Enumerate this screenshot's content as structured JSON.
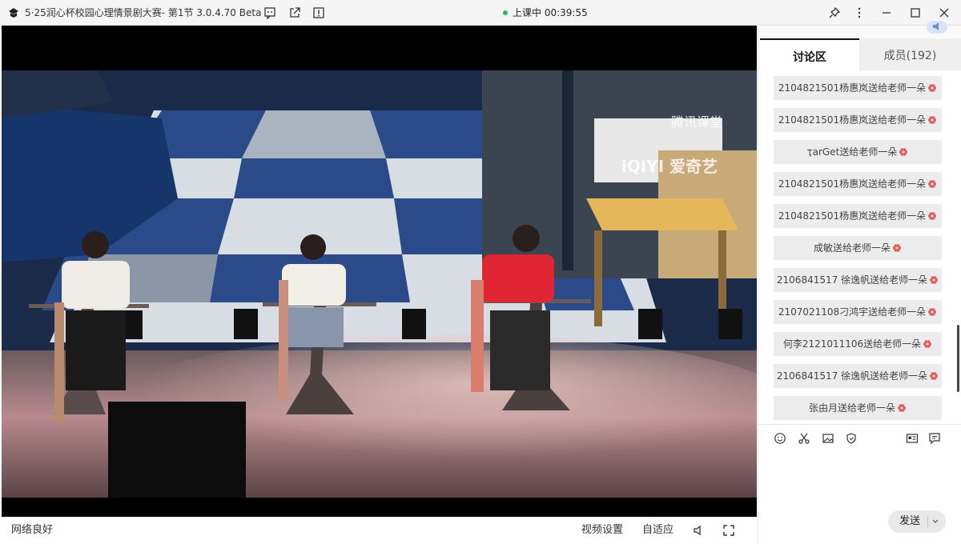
{
  "window": {
    "title": "5·25润心杯校园心理情景剧大赛- 第1节 3.0.4.70 Beta",
    "live_status": "上课中 00:39:55",
    "colors": {
      "live_dot": "#1fbf5a",
      "flower": "#e05a5a"
    }
  },
  "icons": {
    "title_bar": [
      "feedback-icon",
      "popout-icon",
      "info-icon"
    ],
    "window_controls": [
      "pin-icon",
      "more-icon",
      "minimize-icon",
      "maximize-icon",
      "close-icon"
    ]
  },
  "video": {
    "watermark_tencent": "腾讯课堂",
    "watermark_iqiyi": "iQIYI 爱奇艺"
  },
  "bottom_bar": {
    "network_status": "网络良好",
    "video_settings": "视频设置",
    "fit_mode": "自适应"
  },
  "panel": {
    "tab_discussion": "讨论区",
    "tab_members": "成员(192)",
    "messages": [
      "2104821501杨惠岚送给老师一朵",
      "2104821501杨惠岚送给老师一朵",
      "ҭarGet送给老师一朵",
      "2104821501杨惠岚送给老师一朵",
      "2104821501杨惠岚送给老师一朵",
      "成敏送给老师一朵",
      "2106841517 徐逸帆送给老师一朵",
      "2107021108刁鸿宇送给老师一朵",
      "何李2121011106送给老师一朵",
      "2106841517 徐逸帆送给老师一朵",
      "张由月送给老师一朵"
    ],
    "send_label": "发送",
    "tool_icons": [
      "emoji-icon",
      "scissors-icon",
      "image-icon",
      "shield-icon",
      "card-icon",
      "chat-bubble-icon"
    ]
  }
}
